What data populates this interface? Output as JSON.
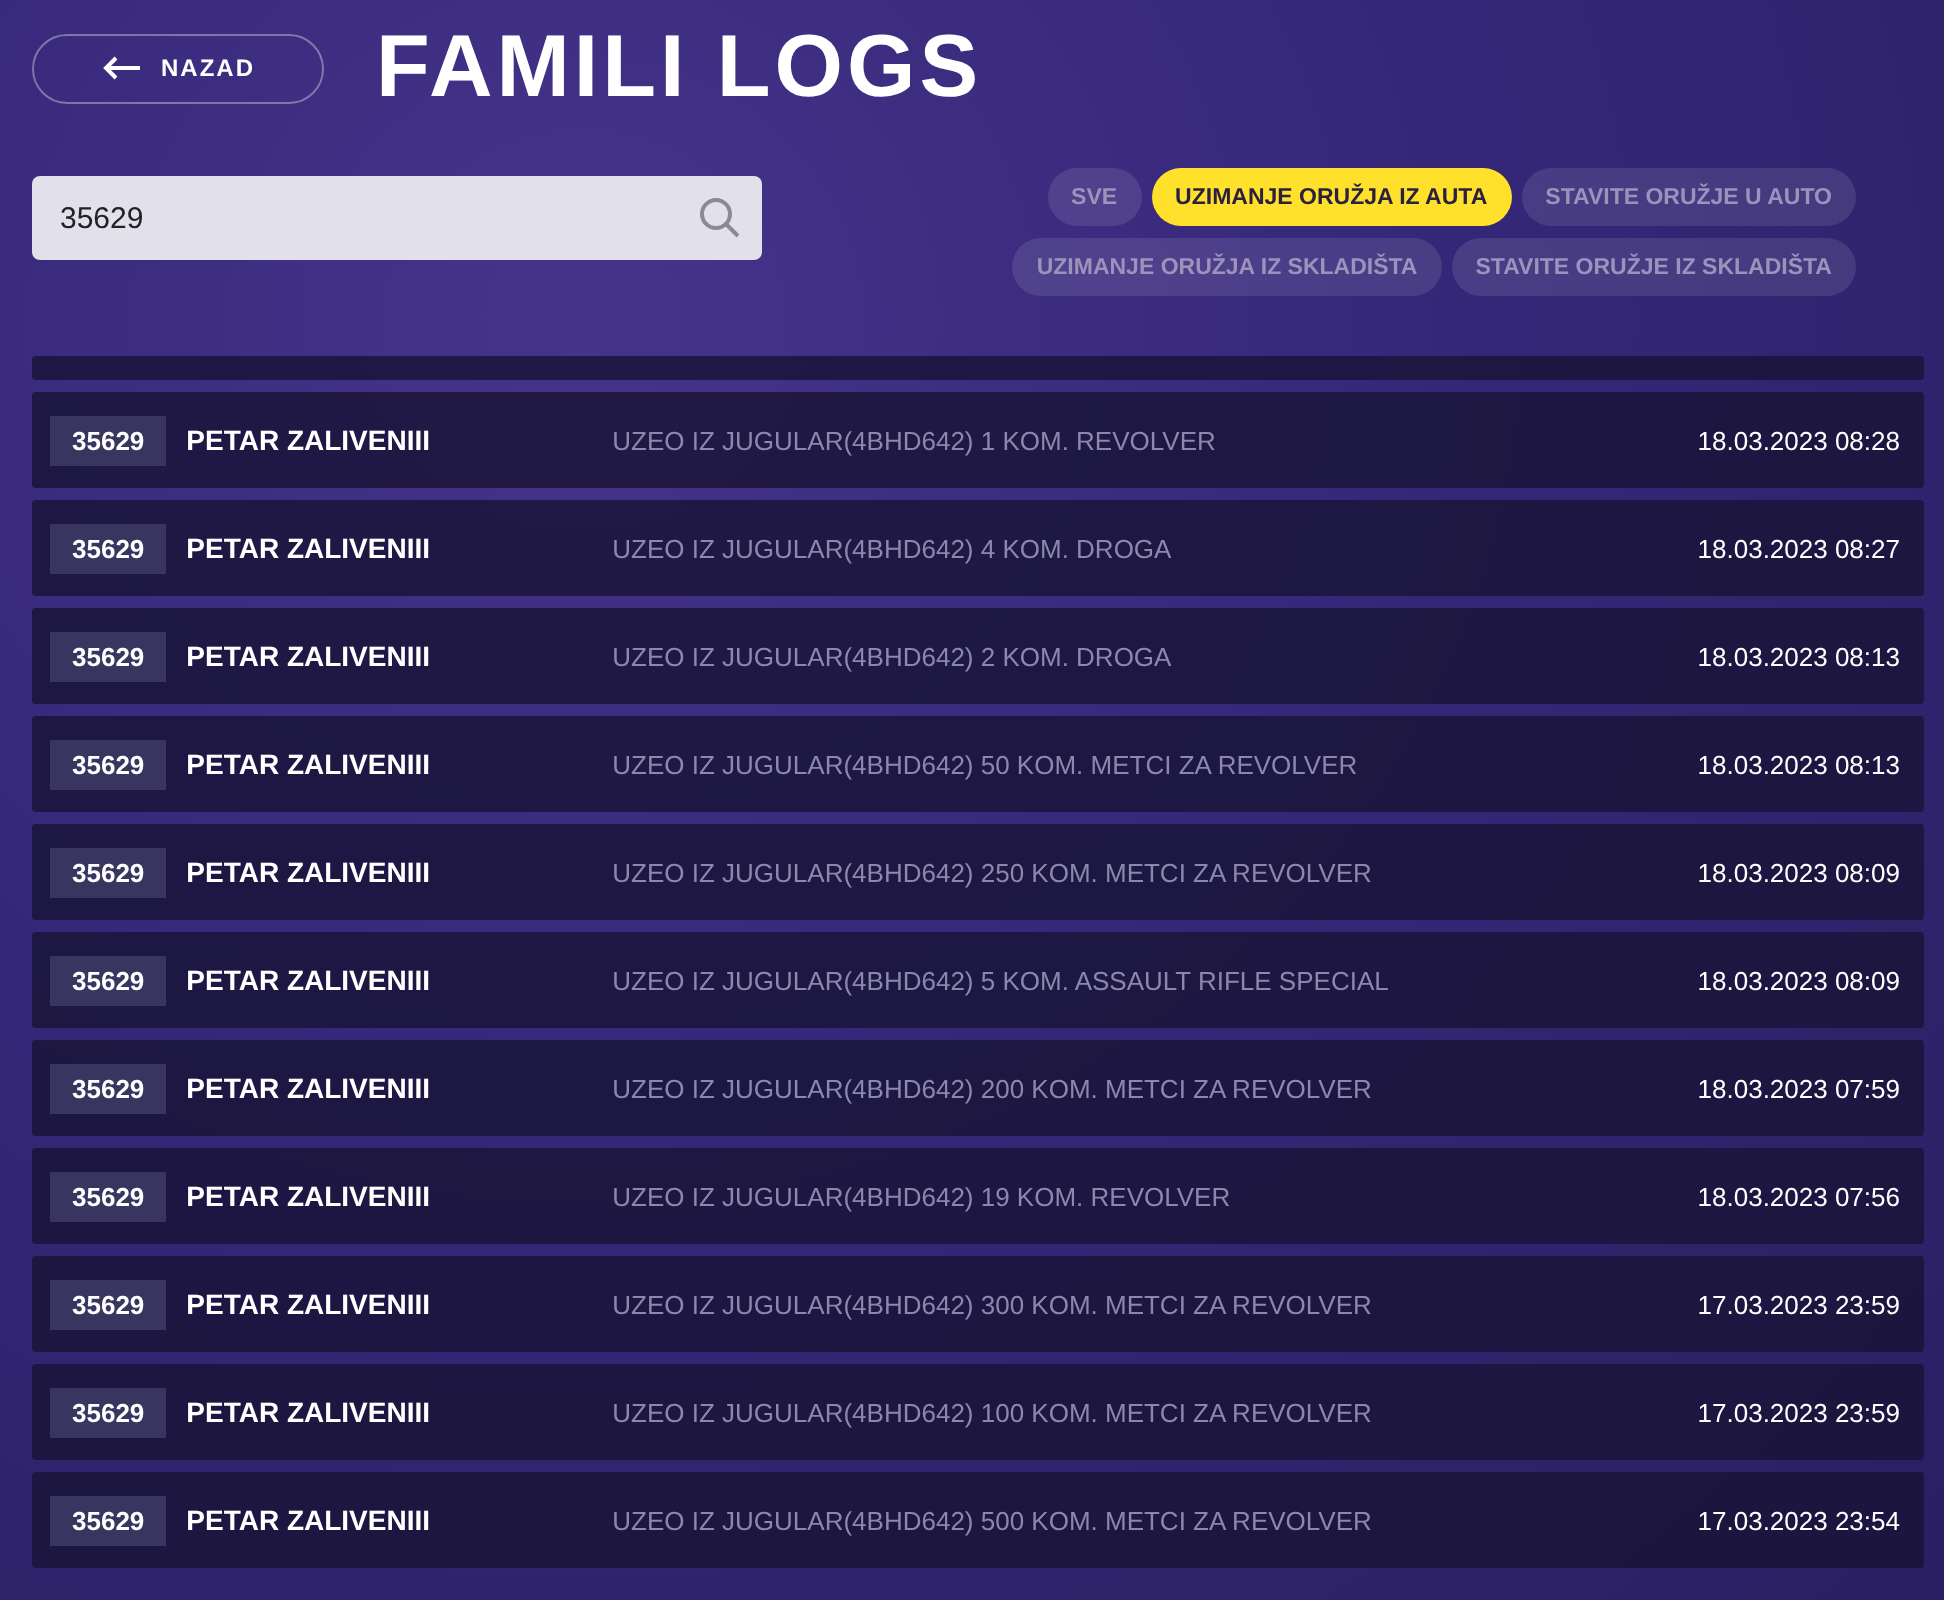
{
  "back_button": {
    "label": "NAZAD"
  },
  "title": "FAMILI LOGS",
  "search": {
    "value": "35629"
  },
  "filters": [
    {
      "label": "SVE",
      "selected": false
    },
    {
      "label": "UZIMANJE ORUŽJA IZ AUTA",
      "selected": true
    },
    {
      "label": "STAVITE ORUŽJE U AUTO",
      "selected": false
    },
    {
      "label": "UZIMANJE ORUŽJA IZ SKLADIŠTA",
      "selected": false
    },
    {
      "label": "STAVITE ORUŽJE IZ SKLADIŠTA",
      "selected": false
    }
  ],
  "logs": [
    {
      "id": "35629",
      "name": "PETAR ZALIVENIII",
      "action": "UZEO IZ JUGULAR(4BHD642) 1 KOM. REVOLVER",
      "time": "18.03.2023 08:28"
    },
    {
      "id": "35629",
      "name": "PETAR ZALIVENIII",
      "action": "UZEO IZ JUGULAR(4BHD642) 4 KOM. DROGA",
      "time": "18.03.2023 08:27"
    },
    {
      "id": "35629",
      "name": "PETAR ZALIVENIII",
      "action": "UZEO IZ JUGULAR(4BHD642) 2 KOM. DROGA",
      "time": "18.03.2023 08:13"
    },
    {
      "id": "35629",
      "name": "PETAR ZALIVENIII",
      "action": "UZEO IZ JUGULAR(4BHD642) 50 KOM. METCI ZA REVOLVER",
      "time": "18.03.2023 08:13"
    },
    {
      "id": "35629",
      "name": "PETAR ZALIVENIII",
      "action": "UZEO IZ JUGULAR(4BHD642) 250 KOM. METCI ZA REVOLVER",
      "time": "18.03.2023 08:09"
    },
    {
      "id": "35629",
      "name": "PETAR ZALIVENIII",
      "action": "UZEO IZ JUGULAR(4BHD642) 5 KOM. ASSAULT RIFLE SPECIAL",
      "time": "18.03.2023 08:09"
    },
    {
      "id": "35629",
      "name": "PETAR ZALIVENIII",
      "action": "UZEO IZ JUGULAR(4BHD642) 200 KOM. METCI ZA REVOLVER",
      "time": "18.03.2023 07:59"
    },
    {
      "id": "35629",
      "name": "PETAR ZALIVENIII",
      "action": "UZEO IZ JUGULAR(4BHD642) 19 KOM. REVOLVER",
      "time": "18.03.2023 07:56"
    },
    {
      "id": "35629",
      "name": "PETAR ZALIVENIII",
      "action": "UZEO IZ JUGULAR(4BHD642) 300 KOM. METCI ZA REVOLVER",
      "time": "17.03.2023 23:59"
    },
    {
      "id": "35629",
      "name": "PETAR ZALIVENIII",
      "action": "UZEO IZ JUGULAR(4BHD642) 100 KOM. METCI ZA REVOLVER",
      "time": "17.03.2023 23:59"
    },
    {
      "id": "35629",
      "name": "PETAR ZALIVENIII",
      "action": "UZEO IZ JUGULAR(4BHD642) 500 KOM. METCI ZA REVOLVER",
      "time": "17.03.2023 23:54"
    }
  ]
}
